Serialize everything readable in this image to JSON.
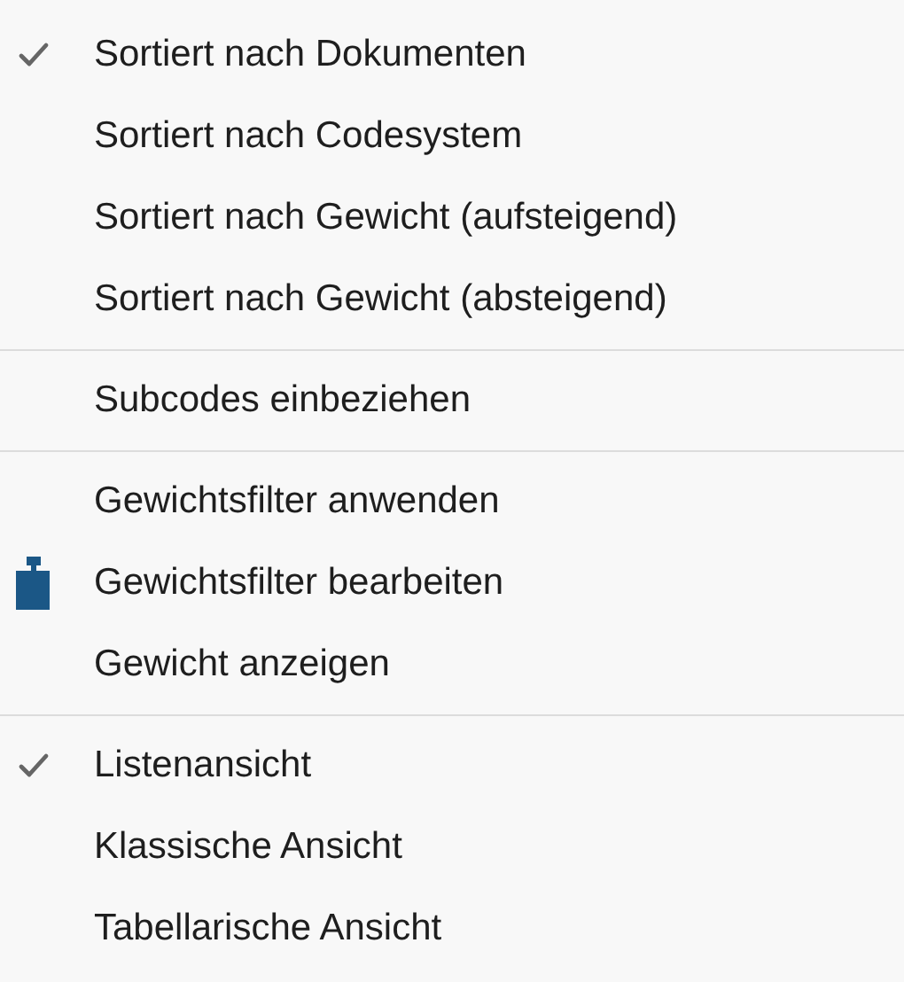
{
  "menu": {
    "sections": [
      {
        "items": [
          {
            "label": "Sortiert nach Dokumenten",
            "checked": true,
            "kind": "plain"
          },
          {
            "label": "Sortiert nach Codesystem",
            "checked": false,
            "kind": "plain"
          },
          {
            "label": "Sortiert nach Gewicht (aufsteigend)",
            "checked": false,
            "kind": "plain"
          },
          {
            "label": "Sortiert nach Gewicht (absteigend)",
            "checked": false,
            "kind": "plain"
          }
        ]
      },
      {
        "items": [
          {
            "label": "Subcodes einbeziehen",
            "checked": false,
            "kind": "plain"
          }
        ]
      },
      {
        "items": [
          {
            "label": "Gewichtsfilter anwenden",
            "checked": false,
            "kind": "plain"
          },
          {
            "label": "Gewichtsfilter bearbeiten",
            "checked": false,
            "kind": "weight"
          },
          {
            "label": "Gewicht anzeigen",
            "checked": false,
            "kind": "plain"
          }
        ]
      },
      {
        "items": [
          {
            "label": "Listenansicht",
            "checked": true,
            "kind": "plain"
          },
          {
            "label": "Klassische Ansicht",
            "checked": false,
            "kind": "plain"
          },
          {
            "label": "Tabellarische Ansicht",
            "checked": false,
            "kind": "plain"
          }
        ]
      }
    ]
  }
}
